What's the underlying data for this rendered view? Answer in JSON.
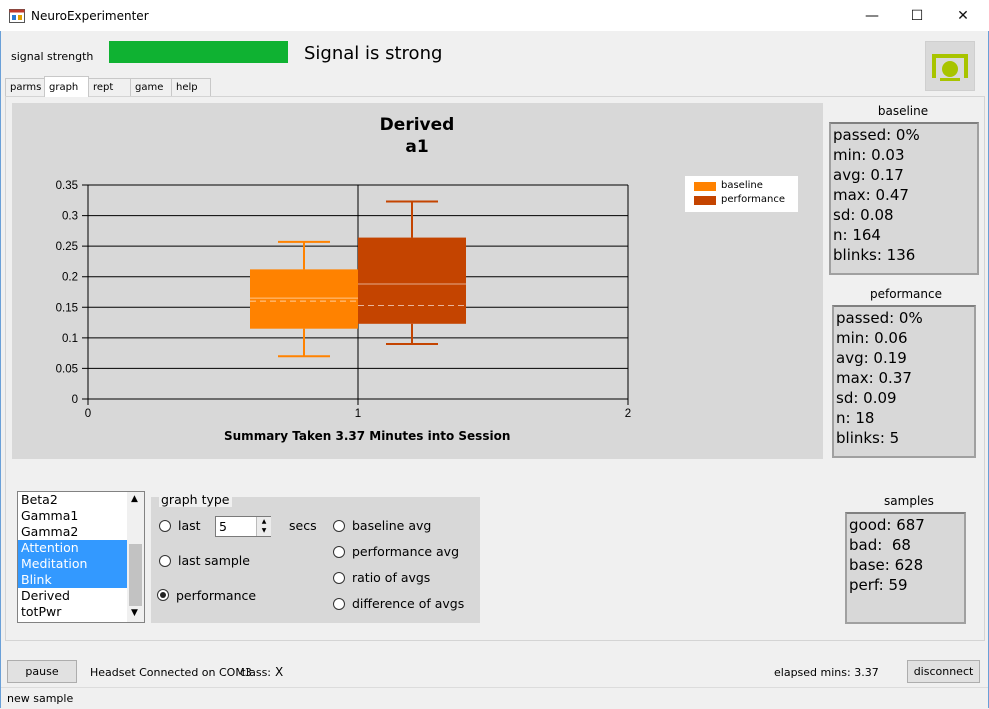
{
  "window": {
    "title": "NeuroExperimenter",
    "minimize": "—",
    "maximize": "☐",
    "close": "✕"
  },
  "signal": {
    "label": "signal strength",
    "status_text": "Signal is strong",
    "bar_color": "#0fb232",
    "level": 1.0
  },
  "tabs": [
    {
      "label": "parms",
      "active": false
    },
    {
      "label": "graph",
      "active": true
    },
    {
      "label": "rept",
      "active": false
    },
    {
      "label": "game",
      "active": false
    },
    {
      "label": "help",
      "active": false
    }
  ],
  "chart_data": {
    "type": "boxplot",
    "title": "Derived",
    "subtitle": "a1",
    "xlabel": "Summary Taken  3.37 Minutes into Session",
    "xlim": [
      0,
      2
    ],
    "ylim": [
      0,
      0.35
    ],
    "x_ticks": [
      "0",
      "1",
      "2"
    ],
    "y_ticks": [
      "0",
      "0.05",
      "0.1",
      "0.15",
      "0.2",
      "0.25",
      "0.3",
      "0.35"
    ],
    "legend_position": "top-right",
    "series": [
      {
        "name": "baseline",
        "color": "#ff8200",
        "x": 0.8,
        "whisker_low": 0.07,
        "q1": 0.115,
        "median": 0.165,
        "mean": 0.16,
        "q3": 0.212,
        "whisker_high": 0.257
      },
      {
        "name": "performance",
        "color": "#c44400",
        "x": 1.2,
        "whisker_low": 0.09,
        "q1": 0.123,
        "median": 0.188,
        "mean": 0.153,
        "q3": 0.264,
        "whisker_high": 0.323
      }
    ]
  },
  "baseline": {
    "title": "baseline",
    "lines": [
      "passed: 0%",
      "min: 0.03",
      "avg: 0.17",
      "max: 0.47",
      "sd: 0.08",
      "n: 164",
      "blinks: 136"
    ]
  },
  "performance": {
    "title": "peformance",
    "lines": [
      "passed: 0%",
      "min: 0.06",
      "avg: 0.19",
      "max: 0.37",
      "sd: 0.09",
      "n: 18",
      "blinks: 5"
    ]
  },
  "samples": {
    "title": "samples",
    "lines": [
      "good: 687",
      "bad:  68",
      "base: 628",
      "perf: 59"
    ]
  },
  "channels": [
    {
      "label": "Beta2",
      "selected": false
    },
    {
      "label": "Gamma1",
      "selected": false
    },
    {
      "label": "Gamma2",
      "selected": false
    },
    {
      "label": "Attention",
      "selected": true
    },
    {
      "label": "Meditation",
      "selected": true
    },
    {
      "label": "Blink",
      "selected": true
    },
    {
      "label": "Derived",
      "selected": false
    },
    {
      "label": "totPwr",
      "selected": false
    }
  ],
  "graph_type": {
    "title": "graph type",
    "last_label": "last",
    "last_value": "5",
    "secs_label": "secs",
    "options_left": [
      {
        "label": "last sample",
        "checked": false
      },
      {
        "label": "performance",
        "checked": true
      }
    ],
    "options_right": [
      {
        "label": "baseline avg",
        "checked": false
      },
      {
        "label": "performance avg",
        "checked": false
      },
      {
        "label": "ratio of avgs",
        "checked": false
      },
      {
        "label": "difference of avgs",
        "checked": false
      }
    ]
  },
  "footer": {
    "pause_label": "pause",
    "connection_text": "Headset Connected on COM3",
    "class_label": "class:",
    "class_value": "X",
    "elapsed_text": "elapsed mins: 3.37",
    "disconnect_label": "disconnect",
    "new_sample_label": "new sample"
  }
}
